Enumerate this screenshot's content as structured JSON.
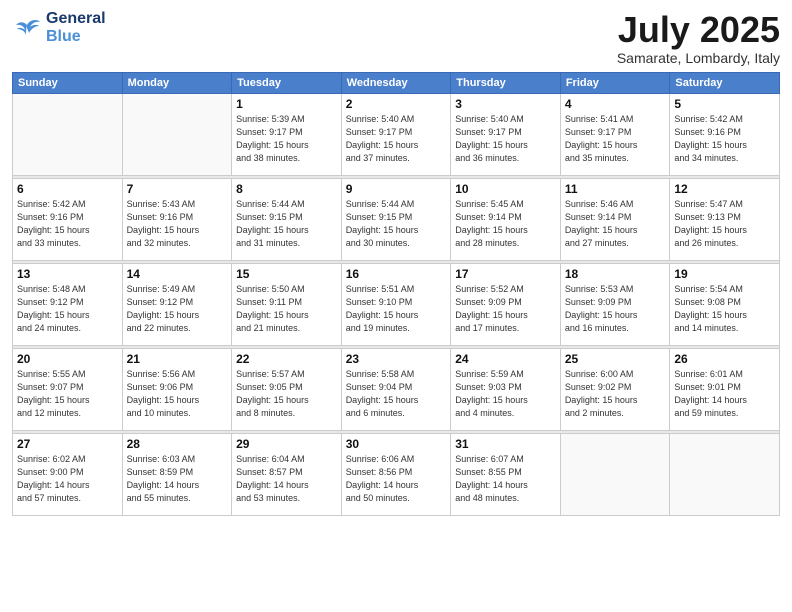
{
  "logo": {
    "line1": "General",
    "line2": "Blue"
  },
  "title": "July 2025",
  "location": "Samarate, Lombardy, Italy",
  "headers": [
    "Sunday",
    "Monday",
    "Tuesday",
    "Wednesday",
    "Thursday",
    "Friday",
    "Saturday"
  ],
  "weeks": [
    [
      {
        "day": "",
        "info": ""
      },
      {
        "day": "",
        "info": ""
      },
      {
        "day": "1",
        "info": "Sunrise: 5:39 AM\nSunset: 9:17 PM\nDaylight: 15 hours\nand 38 minutes."
      },
      {
        "day": "2",
        "info": "Sunrise: 5:40 AM\nSunset: 9:17 PM\nDaylight: 15 hours\nand 37 minutes."
      },
      {
        "day": "3",
        "info": "Sunrise: 5:40 AM\nSunset: 9:17 PM\nDaylight: 15 hours\nand 36 minutes."
      },
      {
        "day": "4",
        "info": "Sunrise: 5:41 AM\nSunset: 9:17 PM\nDaylight: 15 hours\nand 35 minutes."
      },
      {
        "day": "5",
        "info": "Sunrise: 5:42 AM\nSunset: 9:16 PM\nDaylight: 15 hours\nand 34 minutes."
      }
    ],
    [
      {
        "day": "6",
        "info": "Sunrise: 5:42 AM\nSunset: 9:16 PM\nDaylight: 15 hours\nand 33 minutes."
      },
      {
        "day": "7",
        "info": "Sunrise: 5:43 AM\nSunset: 9:16 PM\nDaylight: 15 hours\nand 32 minutes."
      },
      {
        "day": "8",
        "info": "Sunrise: 5:44 AM\nSunset: 9:15 PM\nDaylight: 15 hours\nand 31 minutes."
      },
      {
        "day": "9",
        "info": "Sunrise: 5:44 AM\nSunset: 9:15 PM\nDaylight: 15 hours\nand 30 minutes."
      },
      {
        "day": "10",
        "info": "Sunrise: 5:45 AM\nSunset: 9:14 PM\nDaylight: 15 hours\nand 28 minutes."
      },
      {
        "day": "11",
        "info": "Sunrise: 5:46 AM\nSunset: 9:14 PM\nDaylight: 15 hours\nand 27 minutes."
      },
      {
        "day": "12",
        "info": "Sunrise: 5:47 AM\nSunset: 9:13 PM\nDaylight: 15 hours\nand 26 minutes."
      }
    ],
    [
      {
        "day": "13",
        "info": "Sunrise: 5:48 AM\nSunset: 9:12 PM\nDaylight: 15 hours\nand 24 minutes."
      },
      {
        "day": "14",
        "info": "Sunrise: 5:49 AM\nSunset: 9:12 PM\nDaylight: 15 hours\nand 22 minutes."
      },
      {
        "day": "15",
        "info": "Sunrise: 5:50 AM\nSunset: 9:11 PM\nDaylight: 15 hours\nand 21 minutes."
      },
      {
        "day": "16",
        "info": "Sunrise: 5:51 AM\nSunset: 9:10 PM\nDaylight: 15 hours\nand 19 minutes."
      },
      {
        "day": "17",
        "info": "Sunrise: 5:52 AM\nSunset: 9:09 PM\nDaylight: 15 hours\nand 17 minutes."
      },
      {
        "day": "18",
        "info": "Sunrise: 5:53 AM\nSunset: 9:09 PM\nDaylight: 15 hours\nand 16 minutes."
      },
      {
        "day": "19",
        "info": "Sunrise: 5:54 AM\nSunset: 9:08 PM\nDaylight: 15 hours\nand 14 minutes."
      }
    ],
    [
      {
        "day": "20",
        "info": "Sunrise: 5:55 AM\nSunset: 9:07 PM\nDaylight: 15 hours\nand 12 minutes."
      },
      {
        "day": "21",
        "info": "Sunrise: 5:56 AM\nSunset: 9:06 PM\nDaylight: 15 hours\nand 10 minutes."
      },
      {
        "day": "22",
        "info": "Sunrise: 5:57 AM\nSunset: 9:05 PM\nDaylight: 15 hours\nand 8 minutes."
      },
      {
        "day": "23",
        "info": "Sunrise: 5:58 AM\nSunset: 9:04 PM\nDaylight: 15 hours\nand 6 minutes."
      },
      {
        "day": "24",
        "info": "Sunrise: 5:59 AM\nSunset: 9:03 PM\nDaylight: 15 hours\nand 4 minutes."
      },
      {
        "day": "25",
        "info": "Sunrise: 6:00 AM\nSunset: 9:02 PM\nDaylight: 15 hours\nand 2 minutes."
      },
      {
        "day": "26",
        "info": "Sunrise: 6:01 AM\nSunset: 9:01 PM\nDaylight: 14 hours\nand 59 minutes."
      }
    ],
    [
      {
        "day": "27",
        "info": "Sunrise: 6:02 AM\nSunset: 9:00 PM\nDaylight: 14 hours\nand 57 minutes."
      },
      {
        "day": "28",
        "info": "Sunrise: 6:03 AM\nSunset: 8:59 PM\nDaylight: 14 hours\nand 55 minutes."
      },
      {
        "day": "29",
        "info": "Sunrise: 6:04 AM\nSunset: 8:57 PM\nDaylight: 14 hours\nand 53 minutes."
      },
      {
        "day": "30",
        "info": "Sunrise: 6:06 AM\nSunset: 8:56 PM\nDaylight: 14 hours\nand 50 minutes."
      },
      {
        "day": "31",
        "info": "Sunrise: 6:07 AM\nSunset: 8:55 PM\nDaylight: 14 hours\nand 48 minutes."
      },
      {
        "day": "",
        "info": ""
      },
      {
        "day": "",
        "info": ""
      }
    ]
  ]
}
